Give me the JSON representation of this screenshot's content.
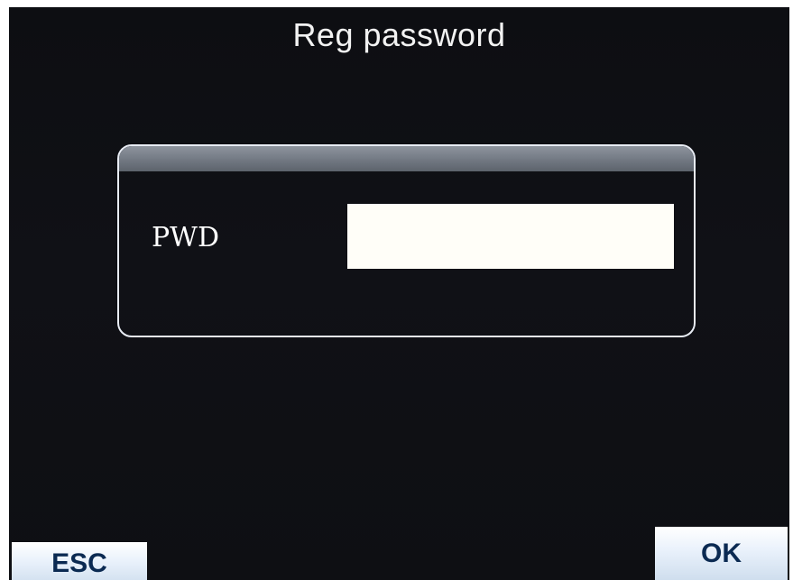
{
  "screen": {
    "title": "Reg password"
  },
  "form": {
    "pwd_label": "PWD",
    "pwd_value": ""
  },
  "softkeys": {
    "esc_label": "ESC",
    "ok_label": "OK"
  },
  "colors": {
    "background": "#0e0f13",
    "dialog_border": "#e8ecf4",
    "dialog_header": "#7a808a",
    "text": "#ffffff",
    "button_text": "#0b2a52"
  }
}
